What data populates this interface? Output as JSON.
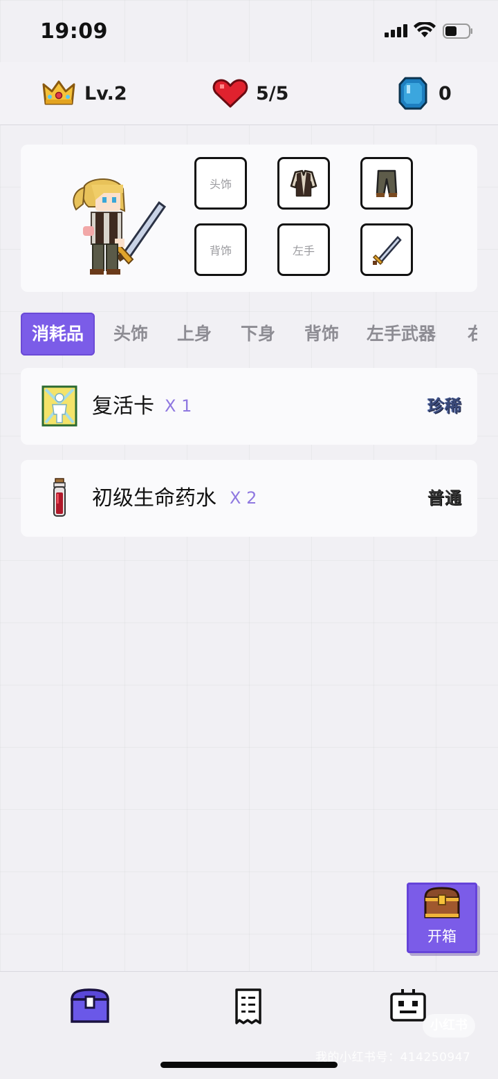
{
  "status_bar": {
    "time": "19:09"
  },
  "stats": {
    "level": "Lv.2",
    "hp": "5/5",
    "gems": "0"
  },
  "equipment": {
    "slots": [
      {
        "label": "头饰",
        "icon": "empty"
      },
      {
        "label": "",
        "icon": "jacket-icon"
      },
      {
        "label": "",
        "icon": "pants-icon"
      },
      {
        "label": "背饰",
        "icon": "empty"
      },
      {
        "label": "左手",
        "icon": "empty"
      },
      {
        "label": "",
        "icon": "sword-icon"
      }
    ]
  },
  "tabs": [
    {
      "label": "消耗品",
      "active": true
    },
    {
      "label": "头饰"
    },
    {
      "label": "上身"
    },
    {
      "label": "下身"
    },
    {
      "label": "背饰"
    },
    {
      "label": "左手武器"
    },
    {
      "label": "右"
    }
  ],
  "inventory": [
    {
      "name": "复活卡",
      "qty": "X 1",
      "rarity": "珍稀",
      "icon": "revive-card-icon"
    },
    {
      "name": "初级生命药水",
      "qty": "X 2",
      "rarity": "普通",
      "icon": "potion-icon"
    }
  ],
  "chest_button": {
    "label": "开箱"
  },
  "bottom_nav": [
    {
      "icon": "chest-icon",
      "active": true
    },
    {
      "icon": "list-icon"
    },
    {
      "icon": "robot-icon"
    }
  ],
  "watermark": {
    "logo": "小红书",
    "text": "我的小红书号：414250947"
  },
  "colors": {
    "accent": "#7b5ce8",
    "background": "#f1f0f4",
    "card": "#fafafc"
  }
}
